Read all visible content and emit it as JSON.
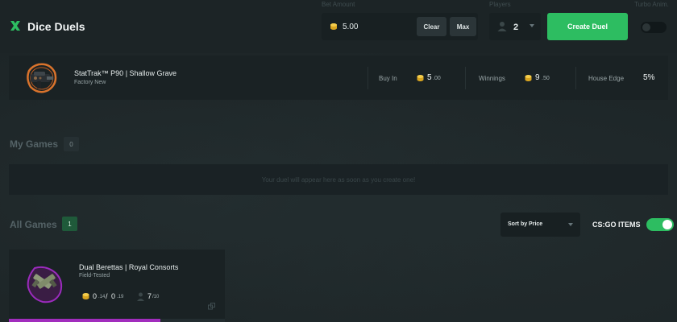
{
  "header": {
    "title": "Dice Duels",
    "bet_label": "Bet Amount",
    "bet_value": "5.00",
    "clear_label": "Clear",
    "max_label": "Max",
    "players_label": "Players",
    "players_value": "2",
    "create_label": "Create Duel",
    "turbo_label": "Turbo Anim.",
    "turbo_on": false
  },
  "item": {
    "name": "StatTrak™ P90 | Shallow Grave",
    "condition": "Factory New",
    "buy_in_label": "Buy In",
    "buy_in_int": "5",
    "buy_in_dec": ".00",
    "winnings_label": "Winnings",
    "winnings_int": "9",
    "winnings_dec": ".50",
    "edge_label": "House Edge",
    "edge_value": "5%"
  },
  "my_games": {
    "title": "My Games",
    "count": "0",
    "empty_message": "Your duel will appear here as soon as you create one!"
  },
  "all_games": {
    "title": "All Games",
    "count": "1",
    "sort_label": "Sort by Price",
    "csgo_label": "CS:GO ITEMS",
    "csgo_on": true,
    "games": [
      {
        "name": "Dual Berettas | Royal Consorts",
        "condition": "Field-Tested",
        "value_a_int": "0",
        "value_a_dec": ".14",
        "separator": "/",
        "value_b_int": "0",
        "value_b_dec": ".19",
        "players_int": "7",
        "players_dec": "/10",
        "progress": 0.7
      }
    ]
  },
  "colors": {
    "accent_green": "#2dbd61",
    "coin_gold": "#e9b72c",
    "purple_rarity": "#a12dbd",
    "orange_rarity": "#d9732c"
  }
}
